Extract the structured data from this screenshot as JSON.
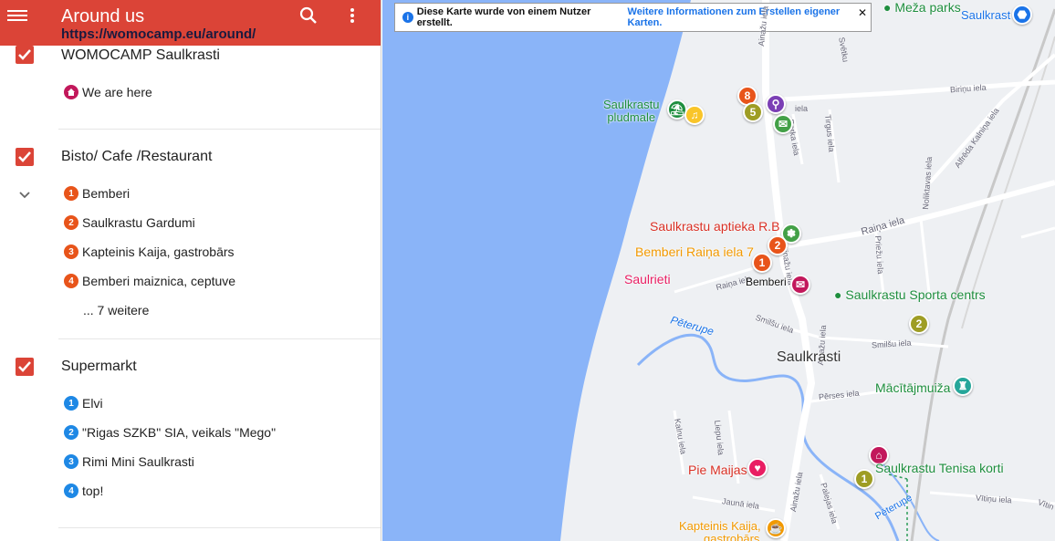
{
  "header": {
    "title": "Around us",
    "url": "https://womocamp.eu/around/"
  },
  "layers": [
    {
      "title": "WOMOCAMP Saulkrasti",
      "items": [
        {
          "label": "We are here",
          "icon": "home-icon",
          "color": "#c2185b"
        }
      ]
    },
    {
      "title": "Bisto/ Cafe /Restaurant",
      "items": [
        {
          "label": "Bemberi",
          "marker": "1",
          "color": "#e8541a"
        },
        {
          "label": "Saulkrastu Gardumi",
          "marker": "2",
          "color": "#e8541a"
        },
        {
          "label": "Kapteinis Kaija, gastrobārs",
          "marker": "3",
          "color": "#e8541a"
        },
        {
          "label": "Bemberi maiznica, ceptuve",
          "marker": "4",
          "color": "#e8541a"
        }
      ],
      "more": "... 7 weitere"
    },
    {
      "title": "Supermarkt",
      "items": [
        {
          "label": "Elvi",
          "marker": "1",
          "color": "#1e88e5"
        },
        {
          "label": "\"Rigas SZKB\" SIA, veikals \"Mego\"",
          "marker": "2",
          "color": "#1e88e5"
        },
        {
          "label": "Rimi Mini Saulkrasti",
          "marker": "3",
          "color": "#1e88e5"
        },
        {
          "label": "top!",
          "marker": "4",
          "color": "#1e88e5"
        }
      ]
    }
  ],
  "map": {
    "info_text": "Diese Karte wurde von einem Nutzer erstellt.",
    "info_link": "Weitere Informationen zum Erstellen eigener Karten.",
    "close_symbol": "✕",
    "colors": {
      "water": "#8ab4f8",
      "land": "#eef0f3",
      "road": "#ffffff"
    },
    "pois": {
      "meza_parks": "Meža parks",
      "saulkrasti_top": "Saulkrast",
      "beach": "Saulkrastu\npludmale",
      "aptieka": "Saulkrastu aptieka R.B",
      "bemberi_raina": "Bemberi Raiņa iela 7",
      "saulrieti": "Saulrieti",
      "bemberi": "Bemberi",
      "sporta_centrs": "Saulkrastu Sporta centrs",
      "saulkrasti": "Saulkrasti",
      "macitajmuiza": "Mācītājmuiža",
      "tenisa_korti": "Saulkrastu Tenisa korti",
      "pie_maijas": "Pie Maijas",
      "kapteinis": "Kapteinis Kaija,",
      "kapteinis2": "gastrobārs",
      "peterupe": "Pēterupe",
      "peterupe2": "Pēterupe"
    },
    "pins": {
      "p8": "8",
      "p5": "5",
      "p2a": "2",
      "p1a": "1",
      "p2b": "2",
      "p1b": "1"
    },
    "streets": {
      "ainazu1": "Ainažu iela",
      "ainazu2": "Ainažu iela",
      "ainazu3": "Ainažu iela",
      "ainazu4": "Ainažu iela",
      "birinu": "Biriņu iela",
      "raina": "Raiņa iela",
      "raina2": "Raiņa iela",
      "parka": "Parka iela",
      "tirgus": "Tirgus iela",
      "alfreda": "Alfrēda Kalniņa iela",
      "smilsu": "Smilšu iela",
      "smilsu2": "Smilšu iela",
      "perses": "Pērses iela",
      "priezu": "Priežu iela",
      "noliktavas": "Noliktavas iela",
      "kalnu": "Kalnu iela",
      "liepu": "Liepu iela",
      "jauna": "Jaunā iela",
      "palejas": "Palejas iela",
      "vitinu": "Vītiņu iela",
      "svetku": "Svētku",
      "iela_stub": "iela",
      "vitin2": "Vītin"
    }
  }
}
